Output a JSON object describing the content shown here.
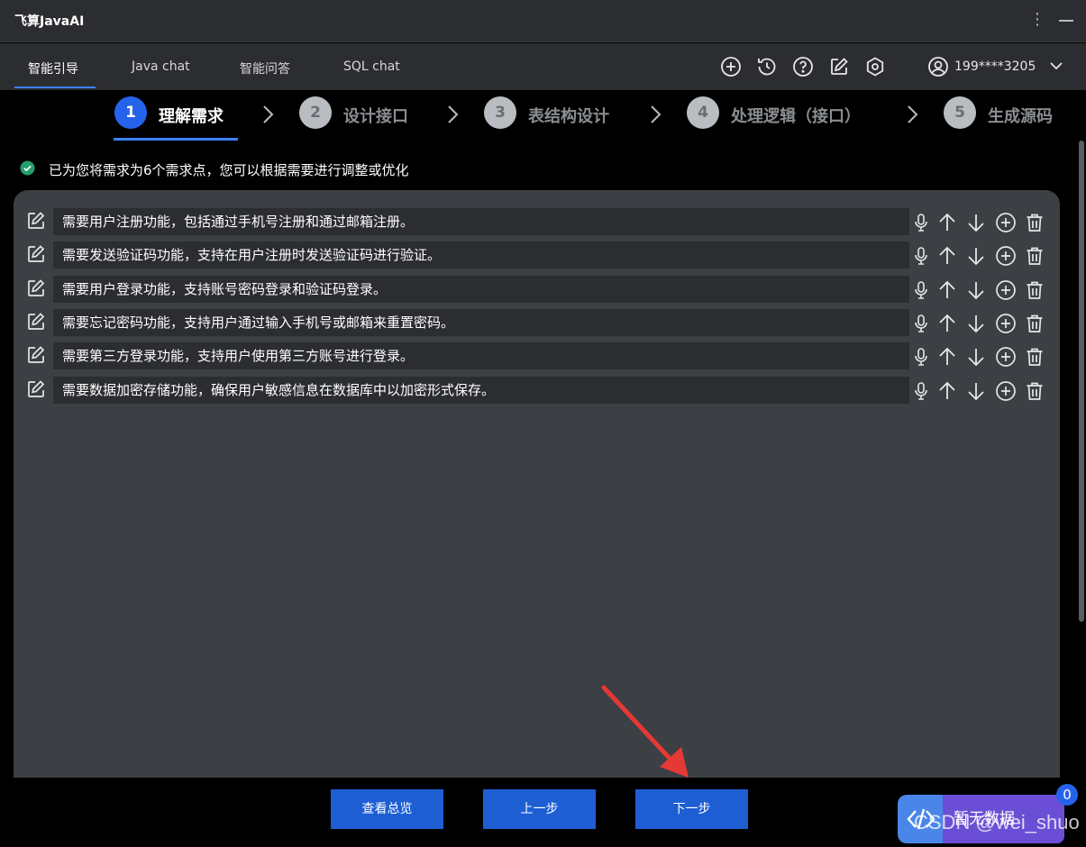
{
  "app": {
    "title": "飞算JavaAI"
  },
  "nav": {
    "tabs": [
      {
        "label": "智能引导",
        "active": true
      },
      {
        "label": "Java chat",
        "active": false
      },
      {
        "label": "智能问答",
        "active": false
      },
      {
        "label": "SQL chat",
        "active": false
      }
    ],
    "toolbar_icons": [
      "add-circle-icon",
      "history-icon",
      "help-icon",
      "edit-icon",
      "settings-icon"
    ],
    "user": {
      "phone": "199****3205",
      "icon": "user-circle-icon"
    }
  },
  "steps": [
    {
      "num": "1",
      "label": "理解需求",
      "active": true
    },
    {
      "num": "2",
      "label": "设计接口",
      "active": false
    },
    {
      "num": "3",
      "label": "表结构设计",
      "active": false
    },
    {
      "num": "4",
      "label": "处理逻辑（接口）",
      "active": false
    },
    {
      "num": "5",
      "label": "生成源码",
      "active": false
    }
  ],
  "info": {
    "text": "已为您将需求为6个需求点，您可以根据需要进行调整或优化",
    "icon": "check-circle-icon"
  },
  "requirements": [
    "需要用户注册功能，包括通过手机号注册和通过邮箱注册。",
    "需要发送验证码功能，支持在用户注册时发送验证码进行验证。",
    "需要用户登录功能，支持账号密码登录和验证码登录。",
    "需要忘记密码功能，支持用户通过输入手机号或邮箱来重置密码。",
    "需要第三方登录功能，支持用户使用第三方账号进行登录。",
    "需要数据加密存储功能，确保用户敏感信息在数据库中以加密形式保存。"
  ],
  "row_actions": [
    "microphone-icon",
    "arrow-up-icon",
    "arrow-down-icon",
    "add-circle-icon",
    "trash-icon"
  ],
  "buttons": {
    "overview": "查看总览",
    "prev": "上一步",
    "next": "下一步"
  },
  "floating": {
    "label": "暂无数据",
    "badge": "0"
  },
  "watermark": "CSDN @wei_shuo",
  "colors": {
    "accent": "#2563eb",
    "button": "#1d5fd3",
    "panel": "#3c3f43",
    "success": "#22a06b",
    "annotation": "#e53935"
  }
}
